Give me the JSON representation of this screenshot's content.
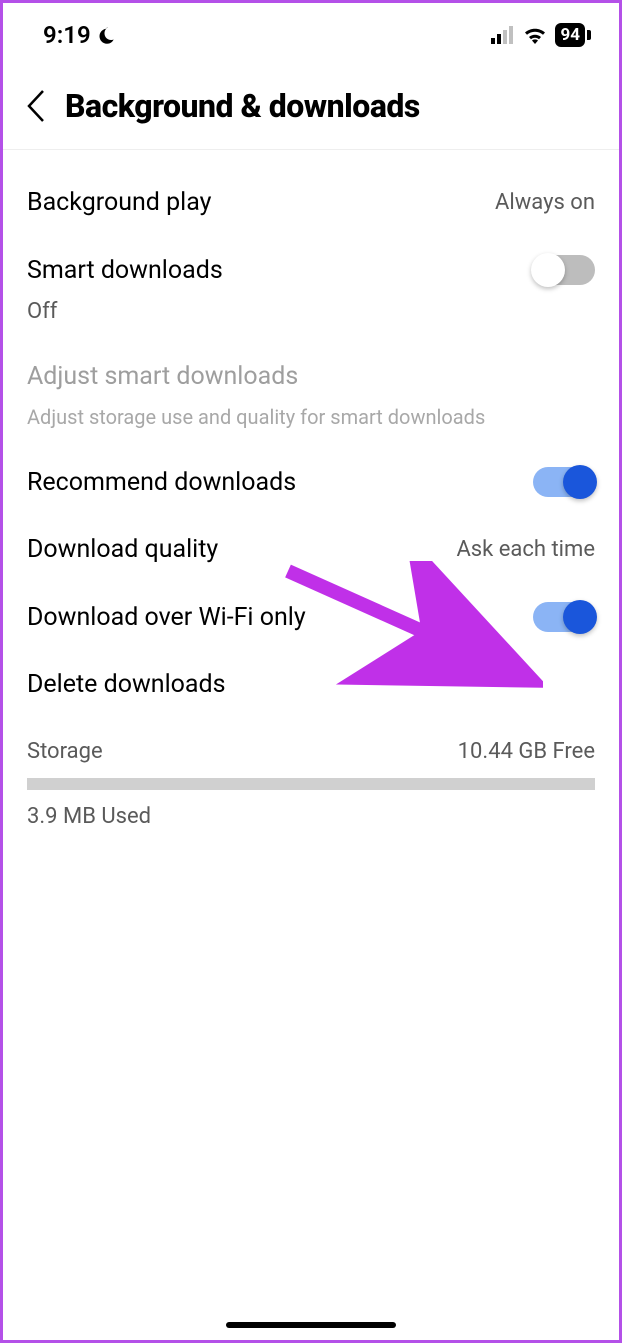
{
  "status": {
    "time": "9:19",
    "battery": "94"
  },
  "header": {
    "title": "Background & downloads"
  },
  "settings": {
    "backgroundPlay": {
      "label": "Background play",
      "value": "Always on"
    },
    "smartDownloads": {
      "label": "Smart downloads",
      "sub": "Off"
    },
    "adjustSmart": {
      "label": "Adjust smart downloads",
      "desc": "Adjust storage use and quality for smart downloads"
    },
    "recommend": {
      "label": "Recommend downloads"
    },
    "quality": {
      "label": "Download quality",
      "value": "Ask each time"
    },
    "wifiOnly": {
      "label": "Download over Wi-Fi only"
    },
    "delete": {
      "label": "Delete downloads"
    }
  },
  "storage": {
    "label": "Storage",
    "free": "10.44 GB Free",
    "used": "3.9 MB Used"
  }
}
